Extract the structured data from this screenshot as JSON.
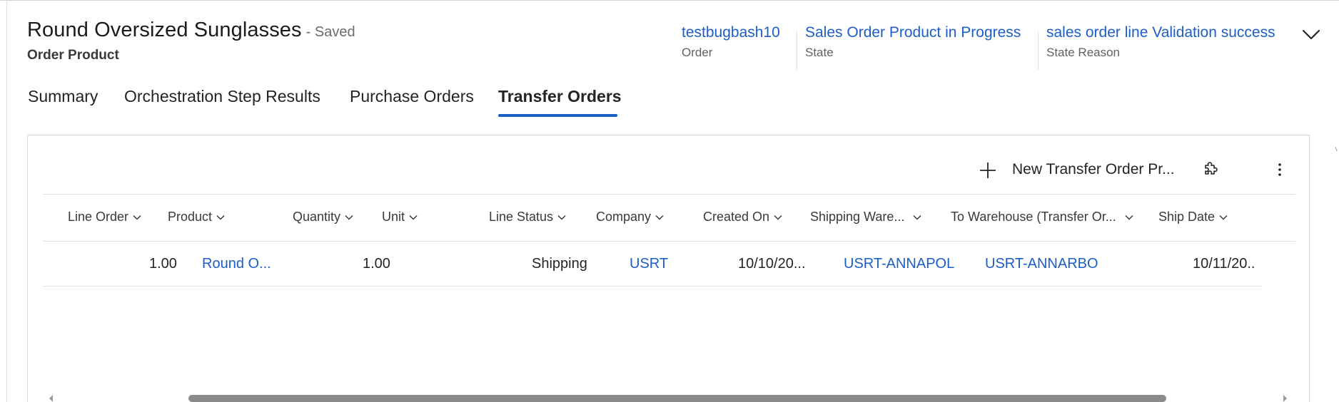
{
  "header": {
    "title": "Round Oversized Sunglasses",
    "saved_status": "- Saved",
    "entity_type": "Order Product",
    "fields": [
      {
        "value": "testbugbash10",
        "label": "Order"
      },
      {
        "value": "Sales Order Product in Progress",
        "label": "State"
      },
      {
        "value": "sales order line Validation success",
        "label": "State Reason"
      }
    ],
    "expand_icon": "chevron-down-icon"
  },
  "tabs": [
    {
      "label": "Summary",
      "active": false
    },
    {
      "label": "Orchestration Step Results",
      "active": false
    },
    {
      "label": "Purchase Orders",
      "active": false
    },
    {
      "label": "Transfer Orders",
      "active": true
    }
  ],
  "grid": {
    "commands": {
      "new_label": "New Transfer Order Pr...",
      "new_icon": "plus-icon",
      "customize_icon": "puzzle-icon",
      "more_icon": "more-vertical-icon"
    },
    "columns": [
      "Line Order",
      "Product",
      "Quantity",
      "Unit",
      "Line Status",
      "Company",
      "Created On",
      "Shipping Ware...",
      "To Warehouse (Transfer Or...",
      "Ship Date"
    ],
    "rows": [
      {
        "line_order": "1.00",
        "product": "Round O...",
        "quantity": "1.00",
        "unit": "",
        "line_status": "Shipping",
        "company": "USRT",
        "created_on": "10/10/20...",
        "shipping_warehouse": "USRT-ANNAPOL",
        "to_warehouse": "USRT-ANNARBO",
        "ship_date": "10/11/20.."
      }
    ]
  },
  "colors": {
    "link": "#1c5ec8",
    "accent": "#1c5ec8",
    "text": "#242424",
    "muted": "#616161",
    "scroll_thumb": "#8a8a8a"
  }
}
